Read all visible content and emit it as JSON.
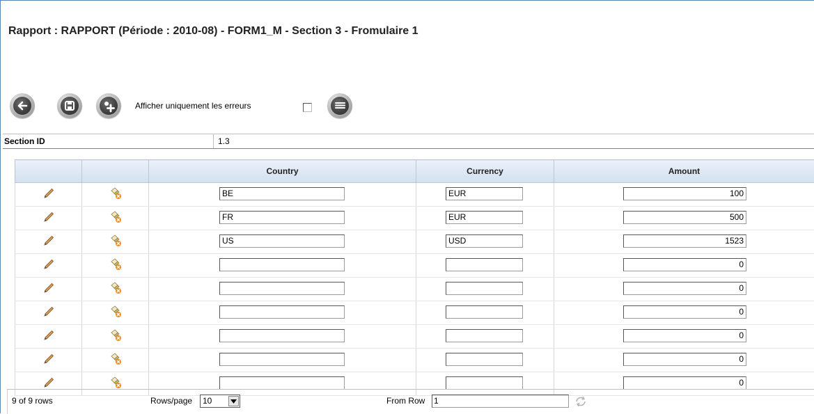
{
  "title": "Rapport : RAPPORT (Période : 2010-08) - FORM1_M - Section 3 - Fromulaire 1",
  "toolbar": {
    "back_icon": "back-arrow-icon",
    "save_icon": "save-disk-icon",
    "add_icon": "add-plus-icon",
    "errors_only_label": "Afficher uniquement les erreurs",
    "errors_only_checked": false,
    "list_icon": "list-icon"
  },
  "section": {
    "label": "Section ID",
    "value": "1.3"
  },
  "grid": {
    "columns": [
      "",
      "",
      "Country",
      "Currency",
      "Amount"
    ],
    "rows": [
      {
        "country": "BE",
        "currency": "EUR",
        "amount": "100"
      },
      {
        "country": "FR",
        "currency": "EUR",
        "amount": "500"
      },
      {
        "country": "US",
        "currency": "USD",
        "amount": "1523"
      },
      {
        "country": "",
        "currency": "",
        "amount": "0"
      },
      {
        "country": "",
        "currency": "",
        "amount": "0"
      },
      {
        "country": "",
        "currency": "",
        "amount": "0"
      },
      {
        "country": "",
        "currency": "",
        "amount": "0"
      },
      {
        "country": "",
        "currency": "",
        "amount": "0"
      },
      {
        "country": "",
        "currency": "",
        "amount": "0"
      }
    ],
    "row_edit_icon": "pencil-icon",
    "row_delete_icon": "eraser-icon"
  },
  "footer": {
    "row_count": "9 of 9 rows",
    "rows_per_page_label": "Rows/page",
    "rows_per_page_value": "10",
    "from_row_label": "From Row",
    "from_row_value": "1",
    "refresh_icon": "refresh-icon"
  }
}
